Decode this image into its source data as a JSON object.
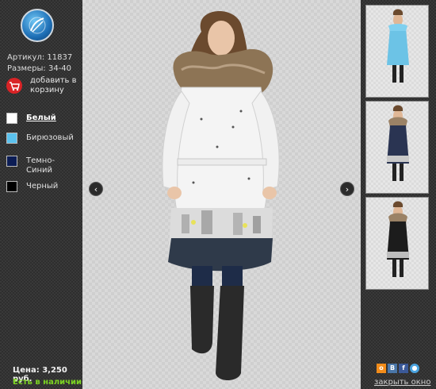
{
  "product": {
    "article": "Артикул: 11837",
    "sizes": "Размеры: 34-40",
    "add_to_cart": "добавить в корзину"
  },
  "colors": [
    {
      "label": "Белый",
      "swatch": "#ffffff",
      "active": true
    },
    {
      "label": "Бирюзовый",
      "swatch": "#5bc2ee",
      "active": false
    },
    {
      "label": "Темно-Синий",
      "swatch": "#0c1d55",
      "active": false
    },
    {
      "label": "Черный",
      "swatch": "#000000",
      "active": false
    }
  ],
  "price": "Цена: 3,250 руб.",
  "stock": "Есть в наличии",
  "nav": {
    "prev": "‹",
    "next": "›"
  },
  "thumbnails": [
    {
      "coat_color": "#6cc3e6",
      "name": "turquoise"
    },
    {
      "coat_color": "#2a3452",
      "name": "navy"
    },
    {
      "coat_color": "#1c1c1c",
      "name": "black"
    }
  ],
  "social": [
    {
      "name": "odnoklassniki-icon",
      "glyph": "о",
      "color": "#f28c1a"
    },
    {
      "name": "vkontakte-icon",
      "glyph": "В",
      "color": "#4a76a8"
    },
    {
      "name": "facebook-icon",
      "glyph": "f",
      "color": "#3b5998"
    },
    {
      "name": "share-icon",
      "glyph": "●",
      "color": "#4aa3df"
    }
  ],
  "close": "закрыть окно"
}
